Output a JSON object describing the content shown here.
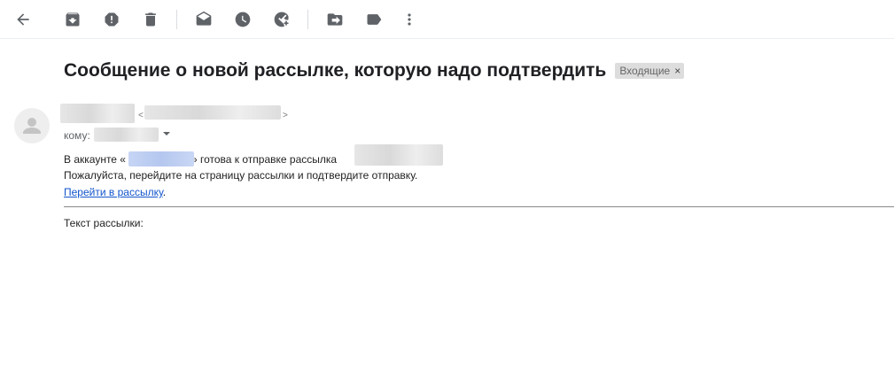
{
  "toolbar": {
    "back_icon": "arrow-back-icon",
    "archive_icon": "archive-icon",
    "spam_icon": "report-spam-icon",
    "delete_icon": "trash-icon",
    "mark_unread_icon": "mark-unread-icon",
    "snooze_icon": "clock-icon",
    "add_task_icon": "add-task-icon",
    "move_icon": "move-to-icon",
    "label_icon": "label-icon",
    "more_icon": "more-vert-icon"
  },
  "email": {
    "subject": "Сообщение о новой рассылке, которую надо подтвердить",
    "label_chip": "Входящие",
    "label_chip_close": "×",
    "sender_open": "<",
    "sender_close": ">",
    "to_prefix": "кому:",
    "line1_prefix": "В аккаунте «",
    "line1_middle": "» готова к отправке рассылка",
    "line2": "Пожалуйста, перейдите на страницу рассылки и подтвердите отправку.",
    "link_text": "Перейти в рассылку",
    "link_suffix": ".",
    "footer_text": "Текст рассылки:"
  },
  "colors": {
    "icon": "#5f6368",
    "link": "#1155cc",
    "chip_bg": "#dddddd"
  }
}
